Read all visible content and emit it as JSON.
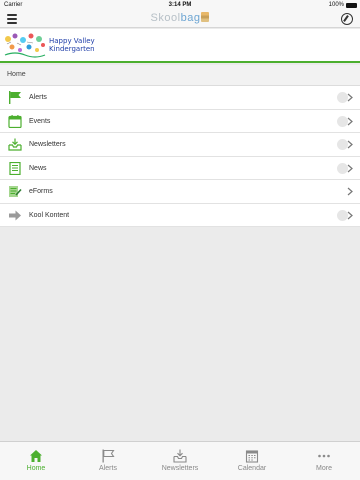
{
  "status_bar": {
    "carrier": "Carrier",
    "time": "3:14 PM",
    "battery": "100%"
  },
  "header": {
    "title_part1": "Skool",
    "title_part2": "bag",
    "menu_icon": "hamburger-menu-icon",
    "refresh_icon": "refresh-icon"
  },
  "banner": {
    "school_name_line1": "Happy Valley",
    "school_name_line2": "Kindergarten"
  },
  "breadcrumb": "Home",
  "menu": {
    "items": [
      {
        "label": "Alerts",
        "icon": "flag-icon",
        "has_badge": true
      },
      {
        "label": "Events",
        "icon": "calendar-icon",
        "has_badge": true
      },
      {
        "label": "Newsletters",
        "icon": "inbox-download-icon",
        "has_badge": true
      },
      {
        "label": "News",
        "icon": "newspaper-icon",
        "has_badge": true
      },
      {
        "label": "eForms",
        "icon": "form-pen-icon",
        "has_badge": false
      },
      {
        "label": "Kool Kontent",
        "icon": "arrow-right-icon",
        "has_badge": true
      }
    ]
  },
  "tabs": [
    {
      "label": "Home",
      "icon": "home-icon",
      "active": true
    },
    {
      "label": "Alerts",
      "icon": "flag-icon",
      "active": false
    },
    {
      "label": "Newsletters",
      "icon": "inbox-download-icon",
      "active": false
    },
    {
      "label": "Calendar",
      "icon": "calendar-icon",
      "active": false
    },
    {
      "label": "More",
      "icon": "more-dots-icon",
      "active": false
    }
  ],
  "colors": {
    "accent_green": "#4caf2f",
    "school_name": "#1e3da8",
    "title_grey": "#b7c0c7",
    "title_blue": "#6ea6d3"
  }
}
